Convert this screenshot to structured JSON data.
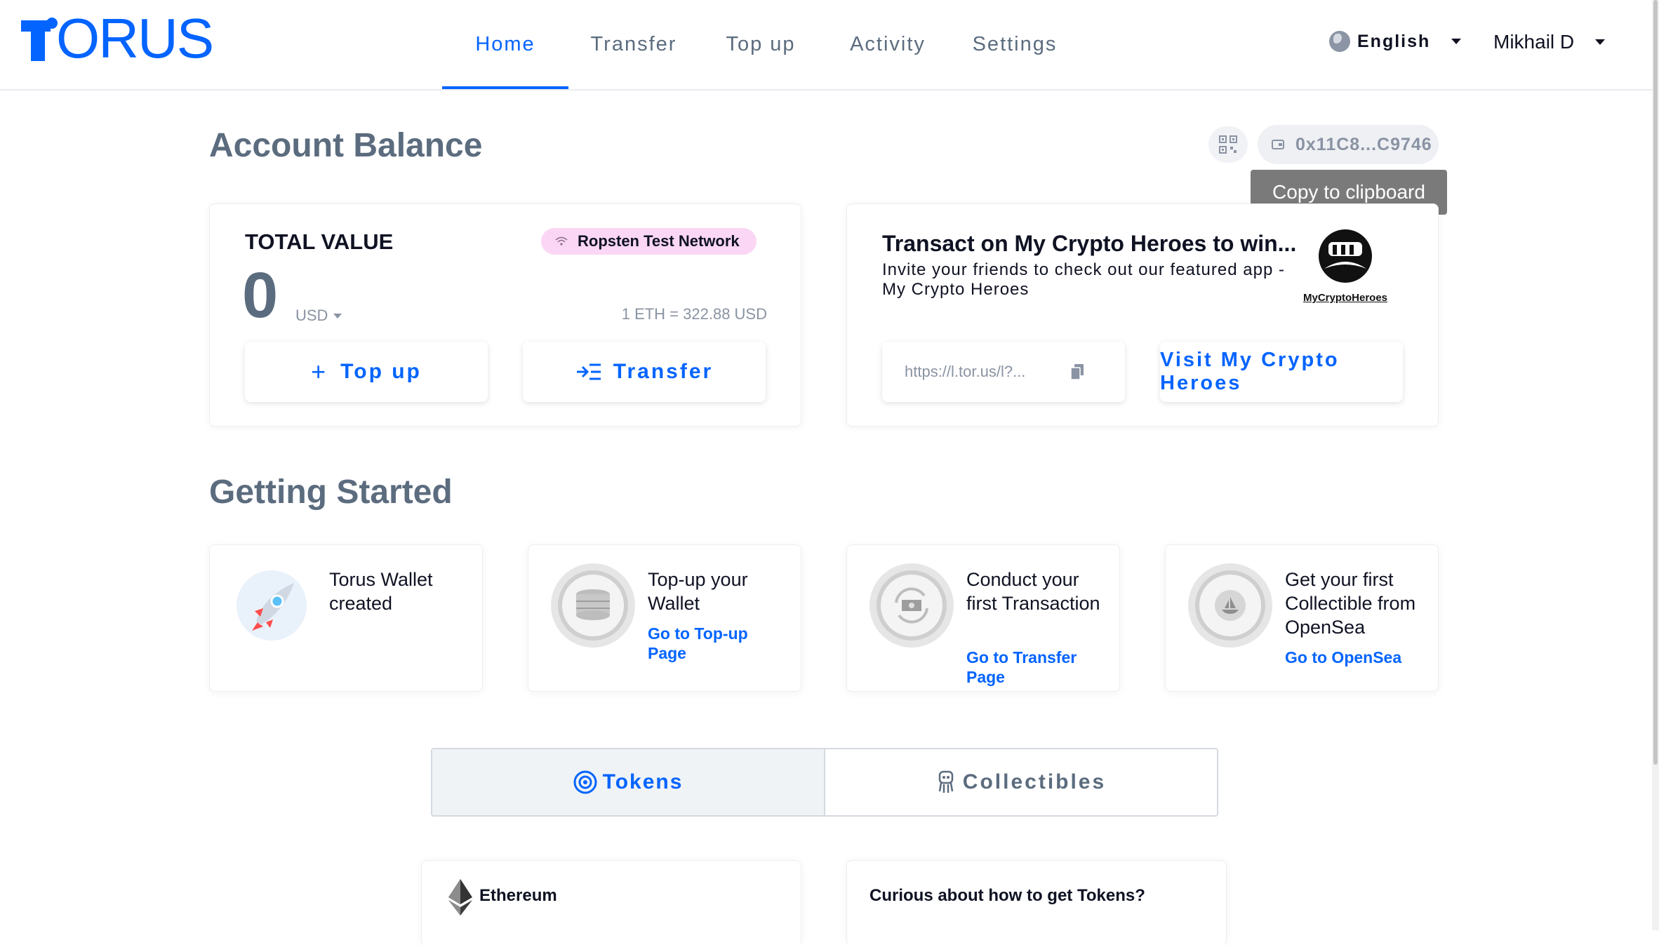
{
  "header": {
    "logo_rest": "ORUS",
    "nav": [
      {
        "label": "Home"
      },
      {
        "label": "Transfer"
      },
      {
        "label": "Top up"
      },
      {
        "label": "Activity"
      },
      {
        "label": "Settings"
      }
    ],
    "language": "English",
    "user": "Mikhail D"
  },
  "balance": {
    "title": "Account Balance",
    "address": "0x11C8...C9746",
    "tooltip": "Copy to clipboard",
    "total_label": "TOTAL VALUE",
    "network": "Ropsten Test Network",
    "amount": "0",
    "currency": "USD",
    "rate": "1 ETH = 322.88 USD",
    "topup_label": "Top up",
    "transfer_label": "Transfer"
  },
  "promo": {
    "title": "Transact on My Crypto Heroes to win...",
    "desc": "Invite your friends to check out our featured app - My Crypto Heroes",
    "link": "https://l.tor.us/l?...",
    "visit_label": "Visit My Crypto Heroes",
    "logo_text": "MyCryptoHeroes"
  },
  "getting_started": {
    "title": "Getting Started",
    "items": [
      {
        "title": "Torus Wallet created",
        "link": ""
      },
      {
        "title": "Top-up your Wallet",
        "link": "Go to Top-up Page"
      },
      {
        "title": "Conduct your first Transaction",
        "link": "Go to Transfer Page"
      },
      {
        "title": "Get your first Collectible from OpenSea",
        "link": "Go to OpenSea"
      }
    ]
  },
  "tabs": [
    {
      "label": "Tokens",
      "active": true
    },
    {
      "label": "Collectibles",
      "active": false
    }
  ],
  "tokens": {
    "eth_name": "Ethereum",
    "curious": "Curious about how to get Tokens?"
  },
  "colors": {
    "accent": "#0364ff",
    "network_bg": "#fbd7f5",
    "tooltip_bg": "#7a7a7a"
  }
}
